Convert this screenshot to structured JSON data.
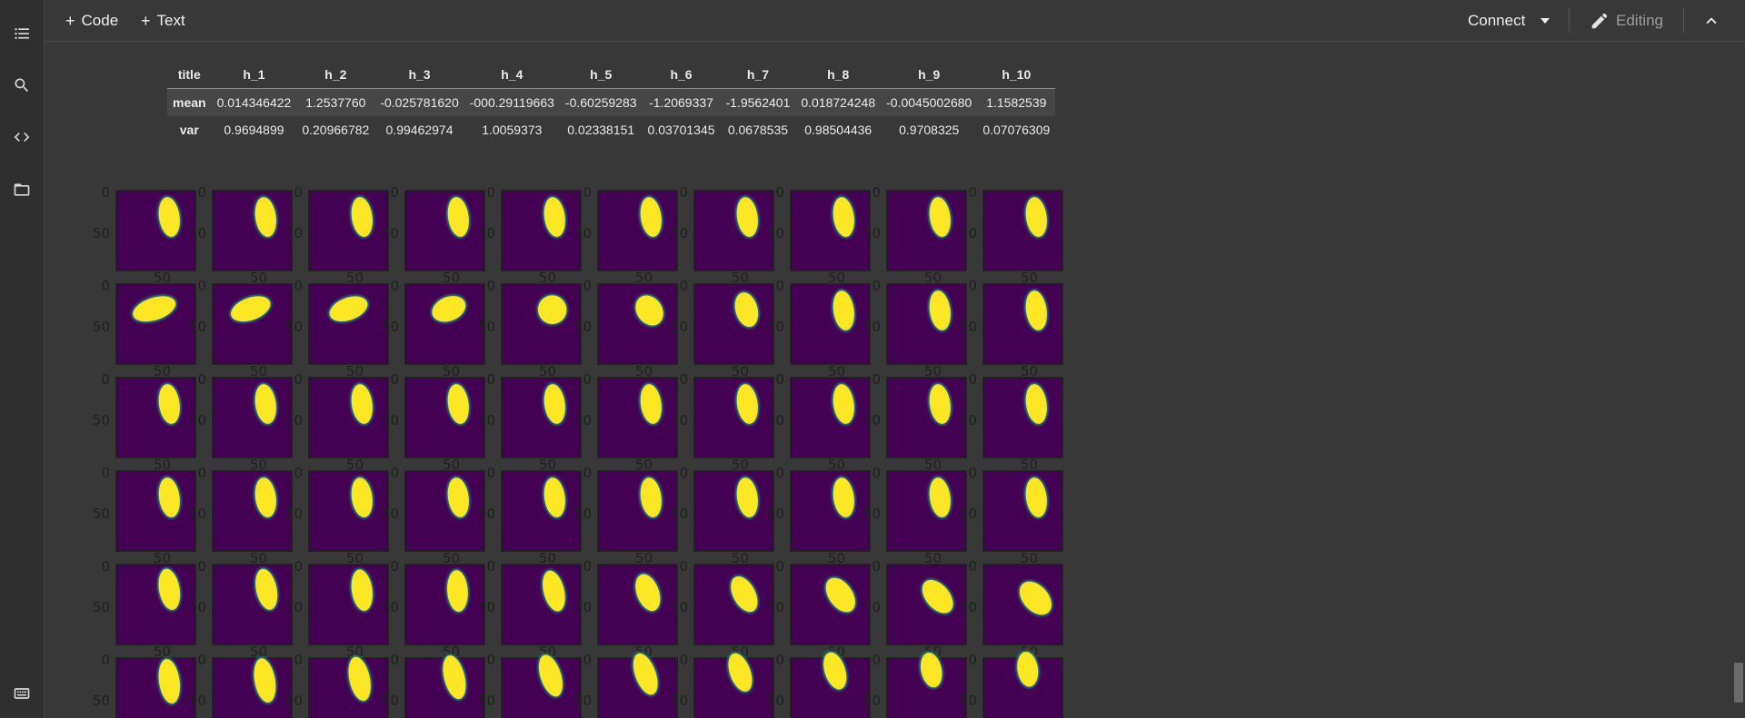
{
  "rail": {
    "items": [
      {
        "icon": "table-of-contents-icon"
      },
      {
        "icon": "search-icon"
      },
      {
        "icon": "code-snippets-icon"
      },
      {
        "icon": "folder-icon"
      }
    ],
    "bottom_icon": "terminal-icon"
  },
  "toolbar": {
    "add_code_label": "Code",
    "add_text_label": "Text",
    "connect_label": "Connect",
    "editing_label": "Editing"
  },
  "stats_table": {
    "headers": [
      "title",
      "h_1",
      "h_2",
      "h_3",
      "h_4",
      "h_5",
      "h_6",
      "h_7",
      "h_8",
      "h_9",
      "h_10"
    ],
    "rows": [
      {
        "label": "mean",
        "values": [
          "0.014346422",
          "1.2537760",
          "-0.025781620",
          "-000.29119663",
          "-0.60259283",
          "-1.2069337",
          "-1.9562401",
          "0.018724248",
          "-0.0045002680",
          "1.1582539"
        ]
      },
      {
        "label": "var",
        "values": [
          "0.9694899",
          "0.20966782",
          "0.99462974",
          "1.0059373",
          "0.02338151",
          "0.03701345",
          "0.0678535",
          "0.98504436",
          "0.9708325",
          "0.07076309"
        ]
      }
    ]
  },
  "figure": {
    "rows": 6,
    "cols": 10,
    "y_tick_labels": [
      "0",
      "50"
    ],
    "x_tick_label": "50",
    "colors": {
      "background": "#440154",
      "blob": "#fde725",
      "edge": "#21918c"
    }
  },
  "colors": {
    "page_bg": "#383838",
    "rail_bg": "#2f2f2f",
    "text": "#e3e3e3"
  }
}
